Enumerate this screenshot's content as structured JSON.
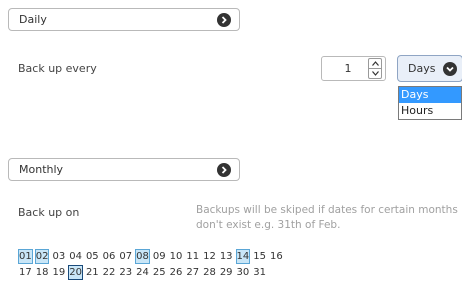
{
  "daily_section": {
    "frequency_label": "Daily",
    "back_up_every_label": "Back up every",
    "interval_value": "1",
    "unit_selected": "Days",
    "unit_options": [
      "Days",
      "Hours"
    ],
    "unit_highlighted": "Days"
  },
  "monthly_section": {
    "frequency_label": "Monthly",
    "back_up_on_label": "Back up on",
    "hint_line1": "Backups will be skiped if dates for certain months",
    "hint_line2": "don't exist e.g. 31th of Feb.",
    "days": [
      "01",
      "02",
      "03",
      "04",
      "05",
      "06",
      "07",
      "08",
      "09",
      "10",
      "11",
      "12",
      "13",
      "14",
      "15",
      "16",
      "17",
      "18",
      "19",
      "20",
      "21",
      "22",
      "23",
      "24",
      "25",
      "26",
      "27",
      "28",
      "29",
      "30",
      "31"
    ],
    "selected_days": [
      "01",
      "02",
      "08",
      "14",
      "20"
    ],
    "focused_day": "20"
  },
  "icons": {
    "frequency_dropdown": "chevron-right-circle-icon",
    "unit_dropdown": "chevron-down-circle-icon",
    "stepper": "up-down-arrows-icon"
  }
}
